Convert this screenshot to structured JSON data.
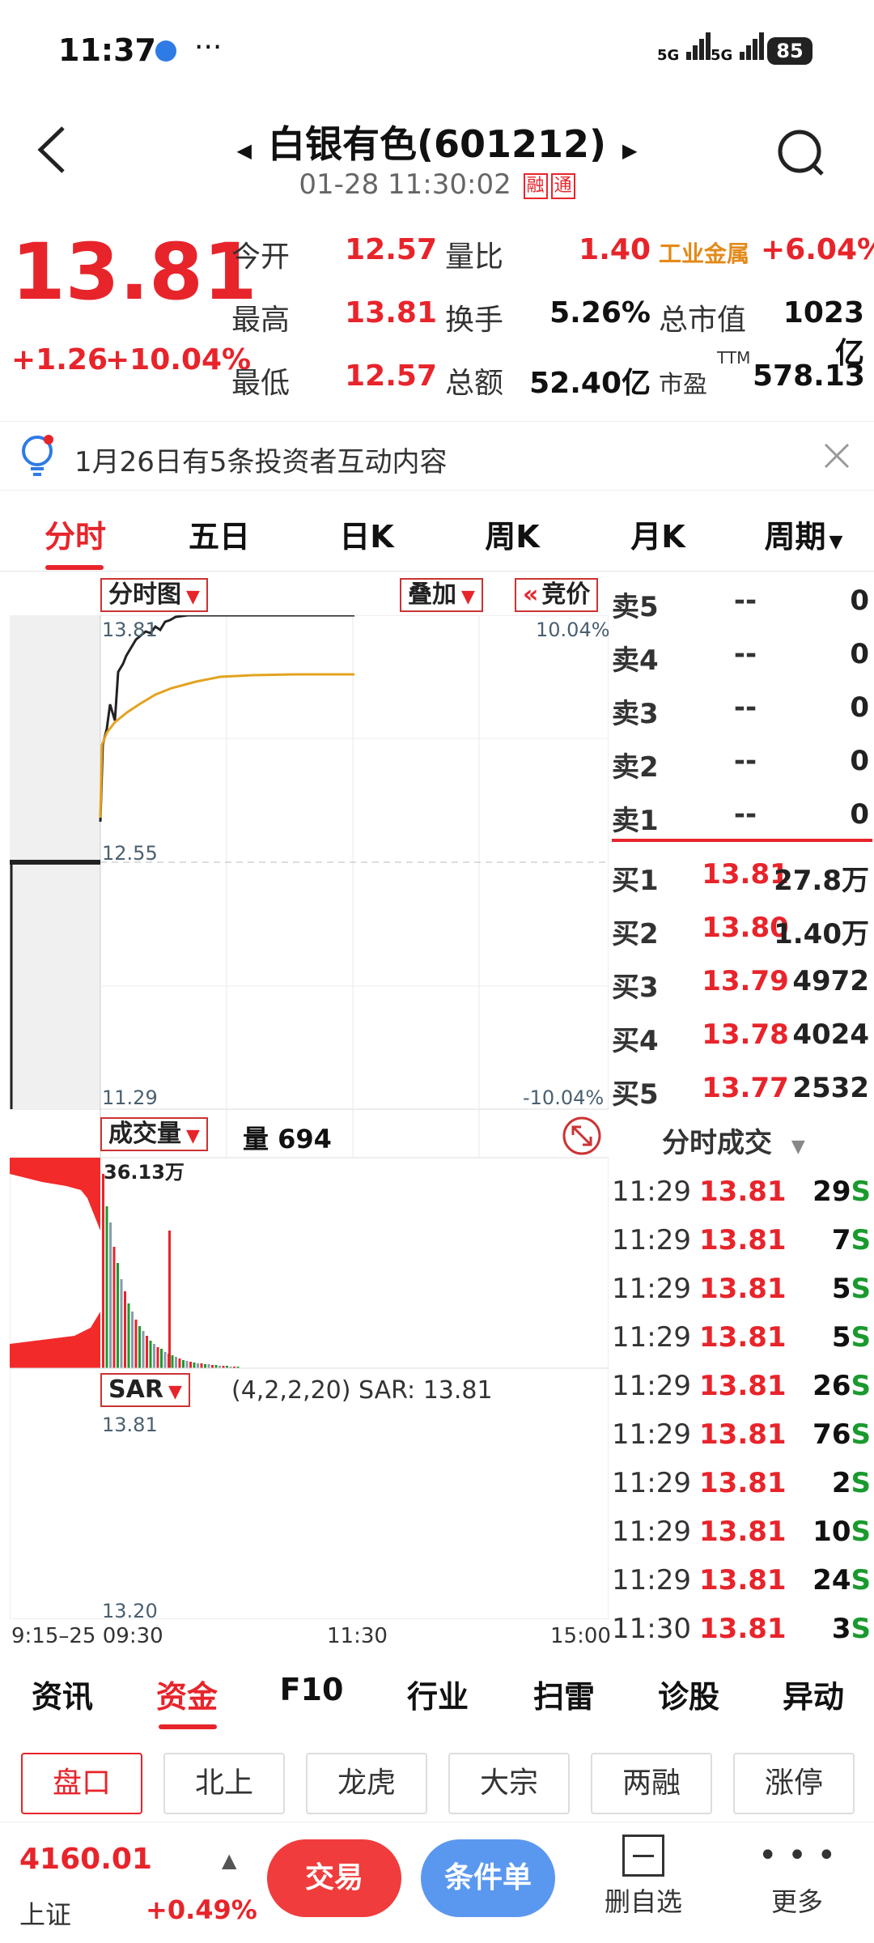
{
  "status": {
    "time": "11:37",
    "dots": "···",
    "signal1": "5G",
    "signal2": "5G",
    "battery": "85"
  },
  "header": {
    "title": "白银有色(601212)",
    "datetime": "01-28 11:30:02",
    "tag1": "融",
    "tag2": "通"
  },
  "quote": {
    "price": "13.81",
    "change": "+1.26",
    "change_pct": "+10.04%",
    "today_open_label": "今开",
    "today_open": "12.57",
    "high_label": "最高",
    "high": "13.81",
    "low_label": "最低",
    "low": "12.57",
    "vol_ratio_label": "量比",
    "vol_ratio": "1.40",
    "turnover_label": "换手",
    "turnover": "5.26%",
    "amount_label": "总额",
    "amount": "52.40亿",
    "sector_label": "工业金属",
    "sector_pct": "+6.04%",
    "mcap_label": "总市值",
    "mcap": "1023亿",
    "pe_label": "市盈",
    "pe_sup": "TTM",
    "pe": "578.13"
  },
  "notice": {
    "text": "1月26日有5条投资者互动内容"
  },
  "tabs": [
    "分时",
    "五日",
    "日K",
    "周K",
    "月K",
    "周期"
  ],
  "chart": {
    "mode_label": "分时图",
    "overlay_label": "叠加",
    "bid_label": "竞价",
    "price_top": "13.81",
    "pct_top": "10.04%",
    "price_mid": "12.55",
    "price_bot": "11.29",
    "pct_bot": "-10.04%",
    "vol_label": "成交量",
    "vol_text": "量 694",
    "vol_max": "36.13万",
    "sar_label": "SAR",
    "sar_params": "(4,2,2,20)",
    "sar_text": "SAR: 13.81",
    "sar_top": "13.81",
    "sar_bot": "13.20",
    "x_start": "9:15–25 09:30",
    "x_mid": "11:30",
    "x_end": "15:00"
  },
  "orderbook": {
    "sells": [
      {
        "name": "卖5",
        "price": "--",
        "vol": "0"
      },
      {
        "name": "卖4",
        "price": "--",
        "vol": "0"
      },
      {
        "name": "卖3",
        "price": "--",
        "vol": "0"
      },
      {
        "name": "卖2",
        "price": "--",
        "vol": "0"
      },
      {
        "name": "卖1",
        "price": "--",
        "vol": "0"
      }
    ],
    "buys": [
      {
        "name": "买1",
        "price": "13.81",
        "vol": "27.8万"
      },
      {
        "name": "买2",
        "price": "13.80",
        "vol": "1.40万"
      },
      {
        "name": "买3",
        "price": "13.79",
        "vol": "4972"
      },
      {
        "name": "买4",
        "price": "13.78",
        "vol": "4024"
      },
      {
        "name": "买5",
        "price": "13.77",
        "vol": "2532"
      }
    ]
  },
  "trades": {
    "title": "分时成交",
    "rows": [
      {
        "time": "11:29",
        "price": "13.81",
        "vol": "29",
        "side": "S"
      },
      {
        "time": "11:29",
        "price": "13.81",
        "vol": "7",
        "side": "S"
      },
      {
        "time": "11:29",
        "price": "13.81",
        "vol": "5",
        "side": "S"
      },
      {
        "time": "11:29",
        "price": "13.81",
        "vol": "5",
        "side": "S"
      },
      {
        "time": "11:29",
        "price": "13.81",
        "vol": "26",
        "side": "S"
      },
      {
        "time": "11:29",
        "price": "13.81",
        "vol": "76",
        "side": "S"
      },
      {
        "time": "11:29",
        "price": "13.81",
        "vol": "2",
        "side": "S"
      },
      {
        "time": "11:29",
        "price": "13.81",
        "vol": "10",
        "side": "S"
      },
      {
        "time": "11:29",
        "price": "13.81",
        "vol": "24",
        "side": "S"
      },
      {
        "time": "11:30",
        "price": "13.81",
        "vol": "3",
        "side": "S"
      }
    ]
  },
  "bottom_tabs": [
    "资讯",
    "资金",
    "F10",
    "行业",
    "扫雷",
    "诊股",
    "异动"
  ],
  "chips": [
    "盘口",
    "北上",
    "龙虎",
    "大宗",
    "两融",
    "涨停"
  ],
  "footer": {
    "index_value": "4160.01",
    "index_name": "上证",
    "index_pct": "+0.49%",
    "trade_label": "交易",
    "cond_label": "条件单",
    "remove_label": "删自选",
    "more_label": "更多"
  },
  "colors": {
    "up": "#e8242b",
    "down": "#1a9a2e",
    "avg_line": "#e3a31f"
  }
}
